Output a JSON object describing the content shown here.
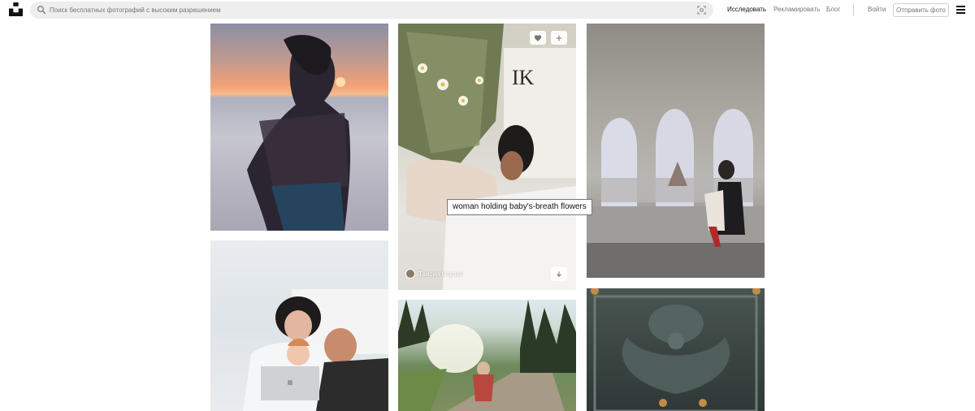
{
  "search": {
    "placeholder": "Поиск бесплатных фотографий с высоким разрешением"
  },
  "nav": {
    "explore": "Исследовать",
    "advertise": "Рекламировать",
    "blog": "Блог",
    "login": "Войти",
    "submit": "Отправить фото"
  },
  "photos": {
    "p2": {
      "author": "Таисия Ступак",
      "tooltip": "woman holding baby's-breath flowers"
    }
  },
  "colors": {
    "header_bg": "#ffffff",
    "search_bg": "#eeeeee",
    "text_muted": "#767676",
    "text_active": "#111111"
  },
  "icons": [
    "unsplash-logo-icon",
    "search-icon",
    "visual-search-icon",
    "menu-icon",
    "heart-icon",
    "plus-icon",
    "download-icon"
  ]
}
